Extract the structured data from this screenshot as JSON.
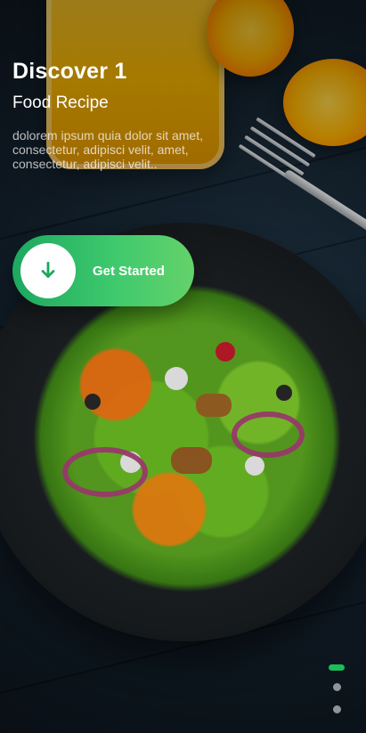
{
  "onboarding": {
    "title": "Discover 1",
    "subtitle": "Food Recipe",
    "description": "dolorem ipsum quia dolor sit amet, consectetur, adipisci velit, amet, consectetur, adipisci velit..",
    "cta": {
      "label": "Get Started",
      "icon": "arrow-down-icon"
    },
    "pagination": {
      "pages": 3,
      "current_index": 0,
      "active_color": "#1bbd5a"
    }
  },
  "colors": {
    "cta_gradient_start": "#1ca85f",
    "cta_gradient_end": "#64d26a",
    "text_primary": "#ffffff"
  }
}
